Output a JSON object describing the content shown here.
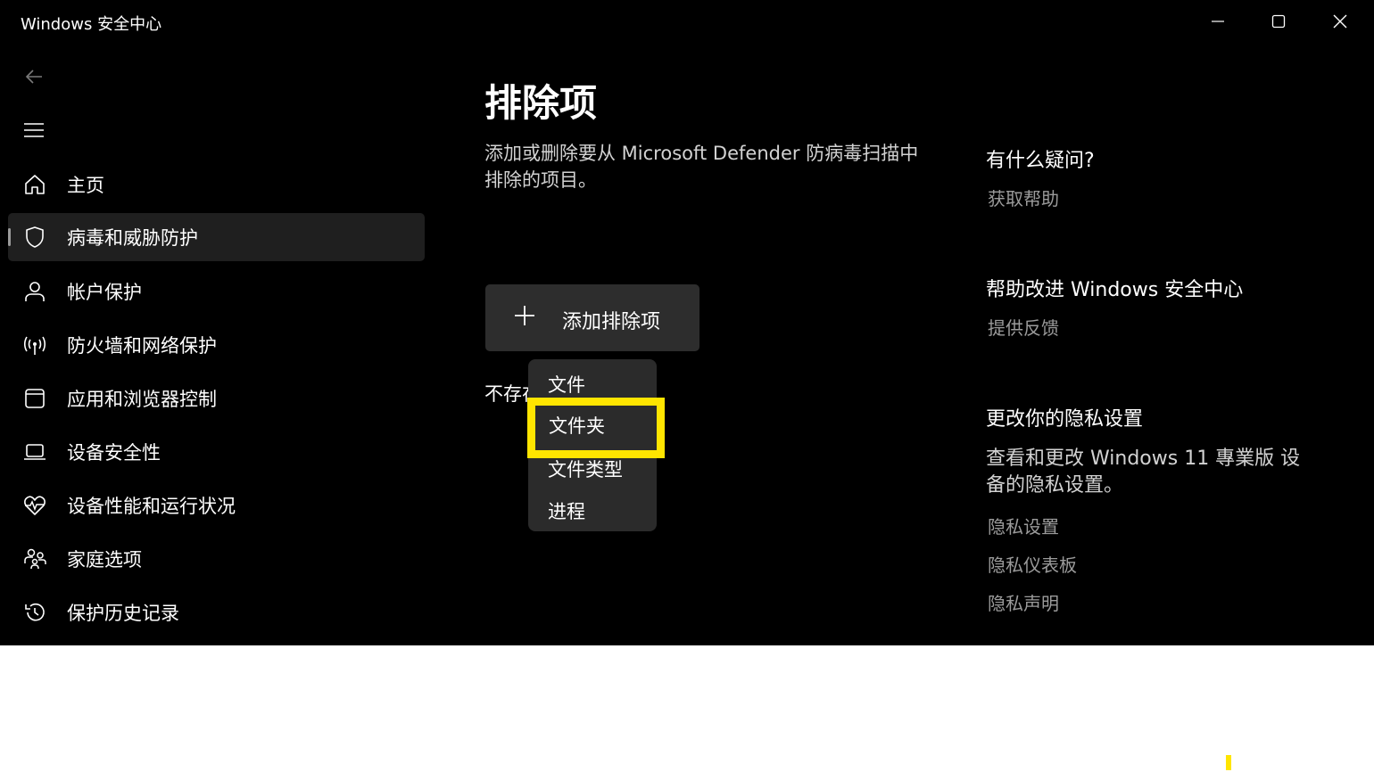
{
  "window": {
    "title": "Windows 安全中心",
    "controls": [
      "minimize-icon",
      "maximize-icon",
      "close-icon"
    ]
  },
  "nav": {
    "back_icon": "back-arrow-icon",
    "menu_icon": "hamburger-menu-icon",
    "items": [
      {
        "label": "主页",
        "icon": "home-icon",
        "active": false
      },
      {
        "label": "病毒和威胁防护",
        "icon": "shield-icon",
        "active": true
      },
      {
        "label": "帐户保护",
        "icon": "person-icon",
        "active": false
      },
      {
        "label": "防火墙和网络保护",
        "icon": "wifi-antenna-icon",
        "active": false
      },
      {
        "label": "应用和浏览器控制",
        "icon": "app-window-icon",
        "active": false
      },
      {
        "label": "设备安全性",
        "icon": "laptop-icon",
        "active": false
      },
      {
        "label": "设备性能和运行状况",
        "icon": "heart-pulse-icon",
        "active": false
      },
      {
        "label": "家庭选项",
        "icon": "family-icon",
        "active": false
      },
      {
        "label": "保护历史记录",
        "icon": "history-icon",
        "active": false
      }
    ]
  },
  "main": {
    "title": "排除项",
    "description": "添加或删除要从 Microsoft Defender 防病毒扫描中排除的项目。",
    "add_button_label": "添加排除项",
    "no_items_text": "不存在",
    "dropdown": {
      "items": [
        "文件",
        "文件夹",
        "文件类型",
        "进程"
      ],
      "highlighted": "文件夹"
    }
  },
  "side": {
    "question_title": "有什么疑问?",
    "get_help": "获取帮助",
    "improve_title": "帮助改进 Windows 安全中心",
    "feedback": "提供反馈",
    "privacy_title": "更改你的隐私设置",
    "privacy_desc": "查看和更改 Windows 11 專業版 设备的隐私设置。",
    "privacy_settings": "隐私设置",
    "privacy_dashboard": "隐私仪表板",
    "privacy_statement": "隐私声明"
  },
  "colors": {
    "background": "#000000",
    "highlight": "#ffe500",
    "button": "#2d2d2d",
    "link": "#9b9b9b"
  }
}
